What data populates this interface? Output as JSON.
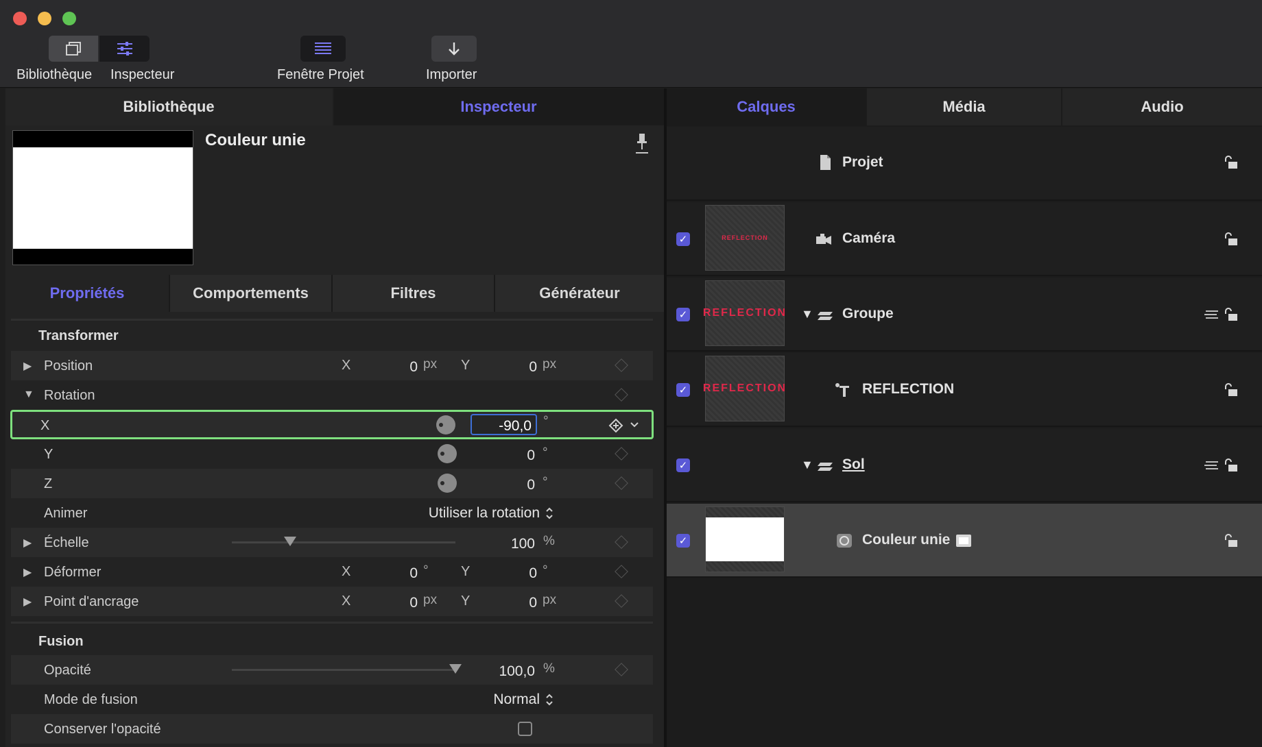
{
  "toolbar": {
    "bibliotheque": "Bibliothèque",
    "inspecteur": "Inspecteur",
    "fenetre_projet": "Fenêtre Projet",
    "importer": "Importer"
  },
  "left_tabs": {
    "bibliotheque": "Bibliothèque",
    "inspecteur": "Inspecteur"
  },
  "right_tabs": {
    "calques": "Calques",
    "media": "Média",
    "audio": "Audio"
  },
  "preview": {
    "title": "Couleur unie"
  },
  "sub_tabs": {
    "proprietes": "Propriétés",
    "comportements": "Comportements",
    "filtres": "Filtres",
    "generateur": "Générateur"
  },
  "transform": {
    "section": "Transformer",
    "position": {
      "label": "Position",
      "x_label": "X",
      "x": "0",
      "x_unit": "px",
      "y_label": "Y",
      "y": "0",
      "y_unit": "px"
    },
    "rotation": {
      "label": "Rotation"
    },
    "rot_x": {
      "label": "X",
      "value": "-90,0",
      "unit": "°"
    },
    "rot_y": {
      "label": "Y",
      "value": "0",
      "unit": "°"
    },
    "rot_z": {
      "label": "Z",
      "value": "0",
      "unit": "°"
    },
    "animer": {
      "label": "Animer",
      "value": "Utiliser la rotation"
    },
    "echelle": {
      "label": "Échelle",
      "value": "100",
      "unit": "%",
      "slider_fraction": 0.26
    },
    "deformer": {
      "label": "Déformer",
      "x_label": "X",
      "x": "0",
      "x_unit": "°",
      "y_label": "Y",
      "y": "0",
      "y_unit": "°"
    },
    "ancrage": {
      "label": "Point d'ancrage",
      "x_label": "X",
      "x": "0",
      "x_unit": "px",
      "y_label": "Y",
      "y": "0",
      "y_unit": "px"
    }
  },
  "fusion": {
    "section": "Fusion",
    "opacite": {
      "label": "Opacité",
      "value": "100,0",
      "unit": "%",
      "slider_fraction": 1.0
    },
    "mode": {
      "label": "Mode de fusion",
      "value": "Normal"
    },
    "conserver": {
      "label": "Conserver l'opacité",
      "checked": false
    }
  },
  "layers": [
    {
      "name": "Projet",
      "icon": "document-icon"
    },
    {
      "name": "Caméra",
      "icon": "camera-icon",
      "thumb_text": "REFLECTION",
      "checked": true
    },
    {
      "name": "Groupe",
      "icon": "group-icon",
      "thumb_text": "REFLECTION",
      "checked": true
    },
    {
      "name": "REFLECTION",
      "icon": "text-layer-icon",
      "thumb_text": "REFLECTION",
      "checked": true
    },
    {
      "name": "Sol",
      "icon": "group-icon",
      "checked": true
    },
    {
      "name": "Couleur unie",
      "icon": "generator-icon",
      "checked": true,
      "selected": true
    }
  ],
  "colors": {
    "accent": "#6f6cf0",
    "highlight": "#7ee07e",
    "thumb_text": "#e0284a"
  }
}
